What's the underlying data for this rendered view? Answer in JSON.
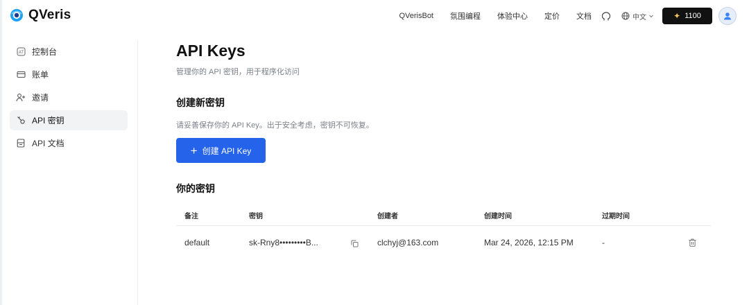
{
  "brand": {
    "name": "QVeris"
  },
  "nav": {
    "items": [
      "QVerisBot",
      "氛围编程",
      "体验中心",
      "定价",
      "文档"
    ],
    "lang": "中文",
    "credits": "1100"
  },
  "sidebar": {
    "items": [
      {
        "label": "控制台",
        "icon": "dashboard-icon"
      },
      {
        "label": "账单",
        "icon": "card-icon"
      },
      {
        "label": "邀请",
        "icon": "user-plus-icon"
      },
      {
        "label": "API 密钥",
        "icon": "key-icon",
        "active": true
      },
      {
        "label": "API 文档",
        "icon": "doc-icon"
      }
    ]
  },
  "page": {
    "title": "API Keys",
    "subtitle": "管理你的 API 密钥，用于程序化访问",
    "create_section_title": "创建新密钥",
    "create_section_desc": "请妥善保存你的 API Key。出于安全考虑，密钥不可恢复。",
    "create_button": "创建 API Key",
    "keys_section_title": "你的密钥"
  },
  "table": {
    "headers": [
      "备注",
      "密钥",
      "创建者",
      "创建时间",
      "过期时间"
    ],
    "rows": [
      {
        "note": "default",
        "key": "sk-Rny8•••••••••B...",
        "creator": "clchyj@163.com",
        "created": "Mar 24, 2026, 12:15 PM",
        "expires": "-"
      }
    ]
  },
  "colors": {
    "accent": "#2563eb",
    "credits_bg": "#111111"
  }
}
